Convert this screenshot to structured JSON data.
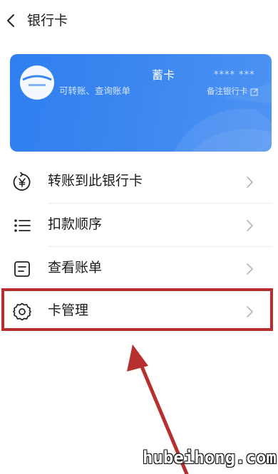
{
  "header": {
    "title": "银行卡"
  },
  "card": {
    "name": "蓄卡",
    "number": "**** ***",
    "subtitle": "可转账、查询账单",
    "remark_label": "备注银行卡",
    "color": "#3b86ef"
  },
  "menu": {
    "items": [
      {
        "label": "转账到此银行卡",
        "icon": "yen-transfer-icon"
      },
      {
        "label": "扣款顺序",
        "icon": "list-icon"
      },
      {
        "label": "查看账单",
        "icon": "bill-icon"
      },
      {
        "label": "卡管理",
        "icon": "gear-icon"
      }
    ]
  },
  "annotation": {
    "highlight_color": "#b82d2d"
  },
  "watermark": {
    "text": "hubeihong.com"
  }
}
